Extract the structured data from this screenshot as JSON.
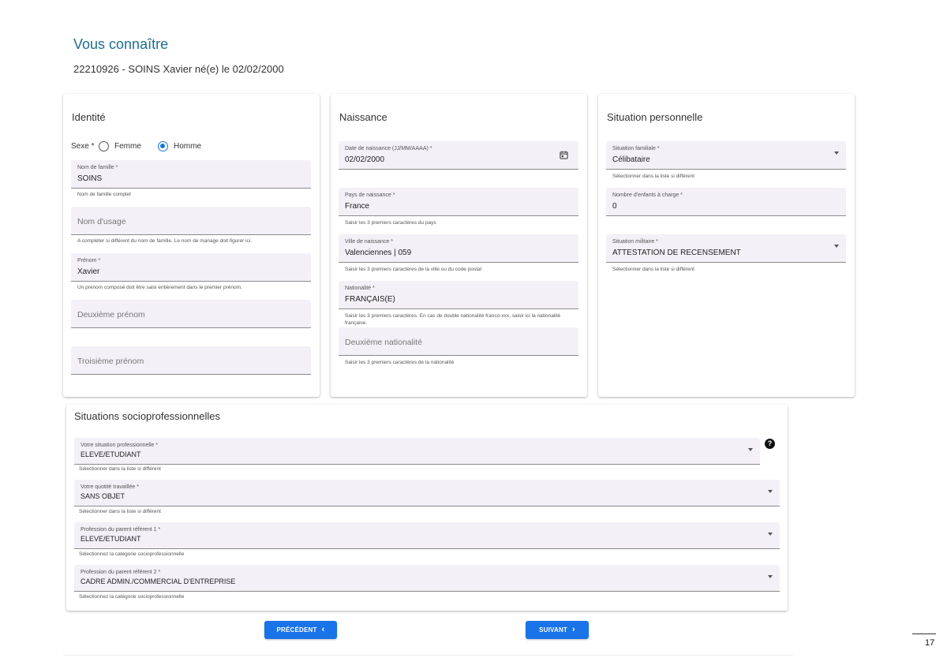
{
  "header": {
    "title": "Vous connaître",
    "subtitle": "22210926 - SOINS Xavier né(e) le 02/02/2000"
  },
  "identite": {
    "title": "Identité",
    "sexe_label": "Sexe *",
    "options": [
      "Femme",
      "Homme"
    ],
    "selected": "Homme",
    "nom_famille": {
      "label": "Nom de famille *",
      "value": "SOINS",
      "hint": "Nom de famille complet"
    },
    "nom_usage": {
      "placeholder": "Nom d'usage",
      "hint": "A compléter si différent du nom de famille. Le nom de mariage doit figurer ici."
    },
    "prenom": {
      "label": "Prénom *",
      "value": "Xavier",
      "hint": "Un prénom composé doit être saisi entièrement dans le premier prénom."
    },
    "deuxieme_prenom": {
      "placeholder": "Deuxième prénom"
    },
    "troisieme_prenom": {
      "placeholder": "Troisième prénom"
    }
  },
  "naissance": {
    "title": "Naissance",
    "date": {
      "label": "Date de naissance (JJ/MM/AAAA) *",
      "value": "02/02/2000"
    },
    "pays": {
      "label": "Pays de naissance *",
      "value": "France",
      "hint": "Saisir les 3 premiers caractères du pays"
    },
    "ville": {
      "label": "Ville de naissance *",
      "value": "Valenciennes | 059",
      "hint": "Saisir les 3 premiers caractères de la ville ou du code postal"
    },
    "nationalite": {
      "label": "Nationalité *",
      "value": "FRANÇAIS(E)",
      "hint": "Saisir les 3 premiers caractères. En cas de double nationalité franco-xxx, saisir ici la nationalité française."
    },
    "deuxieme_nationalite": {
      "placeholder": "Deuxième nationalité",
      "hint": "Saisir les 3 premiers caractères de la nationalité"
    }
  },
  "situation_perso": {
    "title": "Situation personnelle",
    "familiale": {
      "label": "Situation familiale *",
      "value": "Célibataire",
      "hint": "Sélectionner dans la liste si différent"
    },
    "enfants": {
      "label": "Nombre d'enfants à charge *",
      "value": "0"
    },
    "militaire": {
      "label": "Situation militaire *",
      "value": "ATTESTATION DE RECENSEMENT",
      "hint": "Sélectionner dans la liste si différent"
    }
  },
  "socio": {
    "title": "Situations socioprofessionnelles",
    "situation_pro": {
      "label": "Votre situation professionnelle *",
      "value": "ELEVE/ETUDIANT",
      "hint": "Sélectionner dans la liste si différent"
    },
    "quotite": {
      "label": "Votre quotité travaillée *",
      "value": "SANS OBJET",
      "hint": "Sélectionner dans la liste si différent"
    },
    "parent1": {
      "label": "Profession du parent référent 1 *",
      "value": "ELEVE/ETUDIANT",
      "hint": "Sélectionnez la catégorie socioprofessionnelle"
    },
    "parent2": {
      "label": "Profession du parent référent 2 *",
      "value": "CADRE ADMIN./COMMERCIAL D'ENTREPRISE",
      "hint": "Sélectionnez la catégorie socioprofessionnelle"
    },
    "help_glyph": "?"
  },
  "nav": {
    "prev_label": "PRÉCÉDENT",
    "next_label": "SUIVANT"
  },
  "page_number": "17",
  "colors": {
    "primary": "#1a73e8",
    "title": "#1d6f91",
    "field_bg": "#f3f0f7"
  }
}
